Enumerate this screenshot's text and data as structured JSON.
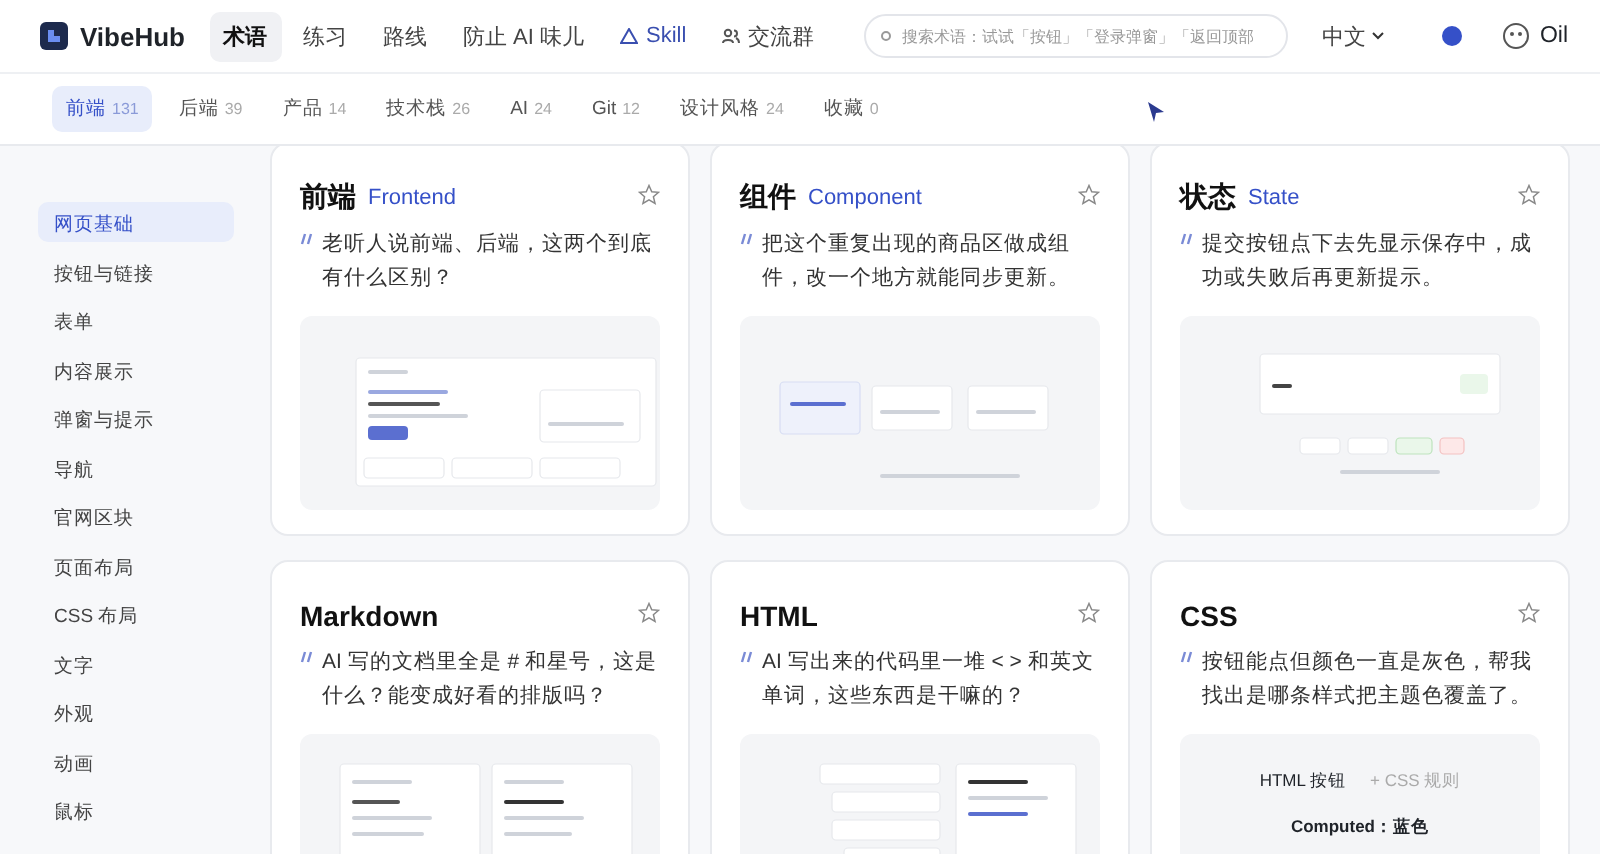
{
  "header": {
    "logo": "VibeHub",
    "nav": [
      {
        "label": "术语",
        "selected": true,
        "kind": "text"
      },
      {
        "label": "练习",
        "selected": false,
        "kind": "text"
      },
      {
        "label": "路线",
        "selected": false,
        "kind": "text"
      },
      {
        "label": "防止 AI 味儿",
        "selected": false,
        "kind": "text"
      },
      {
        "label": "Skill",
        "selected": false,
        "kind": "skill"
      },
      {
        "label": "交流群",
        "selected": false,
        "kind": "group"
      }
    ],
    "search": {
      "placeholder": "搜索术语：试试「按钮」「登录弹窗」「返回顶部"
    },
    "language": "中文",
    "user": "Oil"
  },
  "categories": [
    {
      "label": "前端",
      "count": "131",
      "selected": true
    },
    {
      "label": "后端",
      "count": "39",
      "selected": false
    },
    {
      "label": "产品",
      "count": "14",
      "selected": false
    },
    {
      "label": "技术栈",
      "count": "26",
      "selected": false
    },
    {
      "label": "AI",
      "count": "24",
      "selected": false
    },
    {
      "label": "Git",
      "count": "12",
      "selected": false
    },
    {
      "label": "设计风格",
      "count": "24",
      "selected": false
    },
    {
      "label": "收藏",
      "count": "0",
      "selected": false
    }
  ],
  "sidebar": {
    "items": [
      {
        "label": "网页基础",
        "selected": true
      },
      {
        "label": "按钮与链接",
        "selected": false
      },
      {
        "label": "表单",
        "selected": false
      },
      {
        "label": "内容展示",
        "selected": false
      },
      {
        "label": "弹窗与提示",
        "selected": false
      },
      {
        "label": "导航",
        "selected": false
      },
      {
        "label": "官网区块",
        "selected": false
      },
      {
        "label": "页面布局",
        "selected": false
      },
      {
        "label": "CSS 布局",
        "selected": false
      },
      {
        "label": "文字",
        "selected": false
      },
      {
        "label": "外观",
        "selected": false
      },
      {
        "label": "动画",
        "selected": false
      },
      {
        "label": "鼠标",
        "selected": false
      }
    ]
  },
  "cards": [
    {
      "title": "前端",
      "subtitle": "Frontend",
      "quote": "老听人说前端、后端，这两个到底有什么区别？",
      "favorite": false,
      "preview": {
        "kind": "page"
      }
    },
    {
      "title": "组件",
      "subtitle": "Component",
      "quote": "把这个重复出现的商品区做成组件，改一个地方就能同步更新。",
      "favorite": false,
      "preview": {
        "kind": "component"
      }
    },
    {
      "title": "状态",
      "subtitle": "State",
      "quote": "提交按钮点下去先显示保存中，成功或失败后再更新提示。",
      "favorite": false,
      "preview": {
        "kind": "state"
      }
    },
    {
      "title": "Markdown",
      "quote": "AI 写的文档里全是 # 和星号，这是什么？能变成好看的排版吗？",
      "favorite": false,
      "preview": {
        "kind": "markdown"
      }
    },
    {
      "title": "HTML",
      "quote": "AI 写出来的代码里一堆 < > 和英文单词，这些东西是干嘛的？",
      "favorite": false,
      "preview": {
        "kind": "code"
      }
    },
    {
      "title": "CSS",
      "quote": "按钮能点但颜色一直是灰色，帮我找出是哪条样式把主题色覆盖了。",
      "favorite": false,
      "preview": {
        "kind": "css",
        "texts": [
          "HTML 按钮",
          "+ CSS 规则",
          "Computed：蓝色"
        ]
      }
    }
  ]
}
